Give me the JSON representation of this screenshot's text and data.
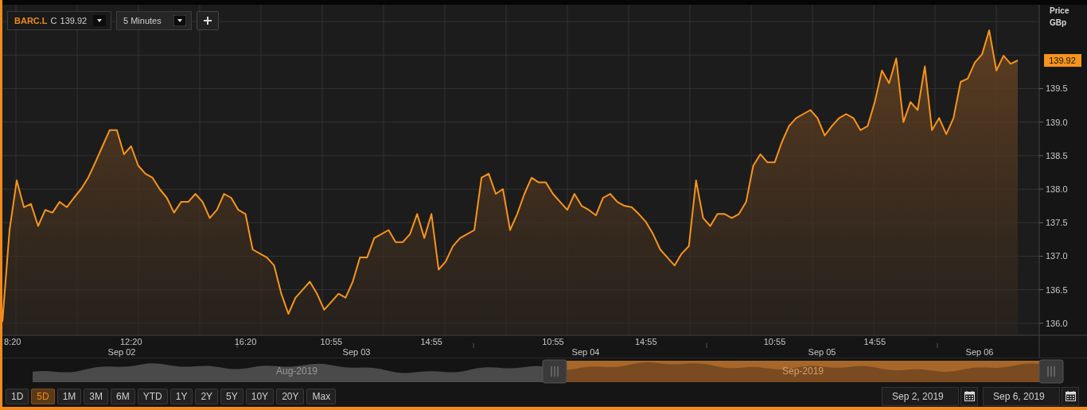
{
  "toolbar": {
    "symbol": "BARC.L",
    "close_prefix": "C",
    "close_value": "139.92",
    "interval": "5 Minutes"
  },
  "chart": {
    "axis_title": "Price",
    "axis_unit": "GBp",
    "last_price": "139.92",
    "chart_data": {
      "type": "area",
      "grid": true,
      "ylim": [
        135.82,
        140.75
      ],
      "categories": [
        null,
        null,
        "8:20",
        null,
        null,
        null,
        null,
        null,
        null,
        null,
        null,
        null,
        null,
        null,
        null,
        null,
        null,
        null,
        "12:20",
        null,
        null,
        null,
        null,
        null,
        null,
        null,
        null,
        null,
        null,
        null,
        null,
        null,
        null,
        null,
        "16:20",
        null,
        null,
        null,
        null,
        null,
        null,
        null,
        null,
        null,
        null,
        null,
        "10:55",
        null,
        null,
        null,
        null,
        null,
        null,
        null,
        null,
        null,
        null,
        null,
        null,
        null,
        "14:55",
        null,
        null,
        null,
        null,
        null,
        null,
        null,
        null,
        null,
        null,
        null,
        null,
        null,
        null,
        null,
        null,
        "10:55",
        null,
        null,
        null,
        null,
        null,
        null,
        null,
        null,
        null,
        null,
        null,
        null,
        "14:55",
        null,
        null,
        null,
        null,
        null,
        null,
        null,
        null,
        null,
        null,
        null,
        null,
        null,
        null,
        null,
        null,
        null,
        "10:55",
        null,
        null,
        null,
        null,
        null,
        null,
        null,
        null,
        null,
        null,
        null,
        null,
        null,
        "14:55",
        null,
        null,
        null,
        null,
        null,
        null,
        null,
        null,
        null,
        null,
        null,
        null,
        null,
        null,
        null,
        null,
        null,
        null,
        null,
        null
      ],
      "series": [
        {
          "color": "#f7941d",
          "values": [
            136.02,
            137.39,
            138.13,
            137.73,
            137.78,
            137.45,
            137.69,
            137.65,
            137.81,
            137.73,
            137.87,
            138.0,
            138.17,
            138.4,
            138.64,
            138.88,
            138.88,
            138.52,
            138.64,
            138.35,
            138.23,
            138.17,
            138.0,
            137.87,
            137.65,
            137.81,
            137.81,
            137.93,
            137.81,
            137.57,
            137.69,
            137.93,
            137.87,
            137.69,
            137.63,
            137.1,
            137.04,
            136.98,
            136.86,
            136.44,
            136.14,
            136.38,
            136.5,
            136.62,
            136.44,
            136.2,
            136.32,
            136.44,
            136.38,
            136.62,
            136.98,
            136.98,
            137.27,
            137.33,
            137.39,
            137.21,
            137.21,
            137.33,
            137.63,
            137.27,
            137.63,
            136.8,
            136.92,
            137.15,
            137.27,
            137.33,
            137.39,
            138.17,
            138.23,
            137.93,
            138.0,
            137.39,
            137.63,
            137.93,
            138.17,
            138.1,
            138.1,
            137.93,
            137.81,
            137.69,
            137.93,
            137.75,
            137.69,
            137.61,
            137.87,
            137.93,
            137.81,
            137.75,
            137.73,
            137.63,
            137.51,
            137.33,
            137.1,
            136.98,
            136.86,
            137.04,
            137.15,
            138.13,
            137.57,
            137.45,
            137.63,
            137.63,
            137.57,
            137.63,
            137.81,
            138.35,
            138.52,
            138.4,
            138.4,
            138.7,
            138.94,
            139.06,
            139.12,
            139.18,
            139.06,
            138.8,
            138.94,
            139.06,
            139.12,
            139.06,
            138.88,
            138.94,
            139.3,
            139.77,
            139.58,
            139.95,
            139.0,
            139.3,
            139.18,
            139.83,
            138.88,
            139.06,
            138.82,
            139.06,
            139.6,
            139.65,
            139.89,
            140.01,
            140.37,
            139.77,
            139.99,
            139.87,
            139.92
          ]
        }
      ],
      "yticks": [
        {
          "value": 136,
          "label": "136.0"
        },
        {
          "value": 136.5,
          "label": "136.5"
        },
        {
          "value": 137,
          "label": "137.0"
        },
        {
          "value": 137.5,
          "label": "137.5"
        },
        {
          "value": 138,
          "label": "138.0"
        },
        {
          "value": 138.5,
          "label": "138.5"
        },
        {
          "value": 139,
          "label": "139.0"
        },
        {
          "value": 139.5,
          "label": "139.5"
        }
      ],
      "annotations": [
        "Sep 02",
        "Sep 03",
        "Sep 04",
        "Sep 05",
        "Sep 06"
      ]
    }
  },
  "navigator": {
    "left_label": "Aug-2019",
    "right_label": "Sep-2019"
  },
  "ranges": [
    {
      "label": "1D",
      "selected": false
    },
    {
      "label": "5D",
      "selected": true
    },
    {
      "label": "1M",
      "selected": false
    },
    {
      "label": "3M",
      "selected": false
    },
    {
      "label": "6M",
      "selected": false
    },
    {
      "label": "YTD",
      "selected": false
    },
    {
      "label": "1Y",
      "selected": false
    },
    {
      "label": "2Y",
      "selected": false
    },
    {
      "label": "5Y",
      "selected": false
    },
    {
      "label": "10Y",
      "selected": false
    },
    {
      "label": "20Y",
      "selected": false
    },
    {
      "label": "Max",
      "selected": false
    }
  ],
  "date_range": {
    "start": "Sep 2, 2019",
    "end": "Sep 6, 2019"
  }
}
